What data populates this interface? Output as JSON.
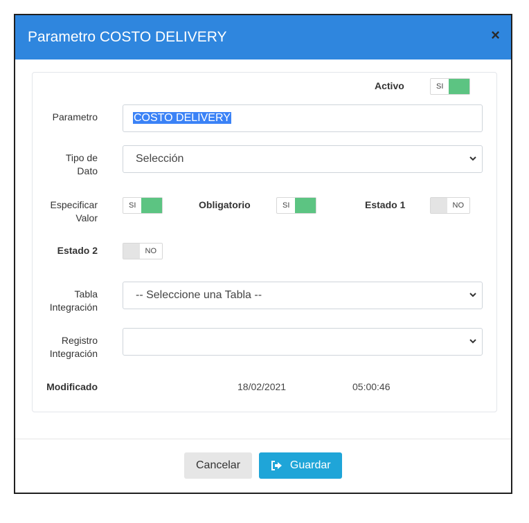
{
  "modal": {
    "title": "Parametro COSTO DELIVERY",
    "close_glyph": "×"
  },
  "form": {
    "activo": {
      "label": "Activo",
      "toggle": "SI",
      "on": true
    },
    "parametro": {
      "label": "Parametro",
      "value": "COSTO DELIVERY"
    },
    "tipo_dato": {
      "label_line1": "Tipo de",
      "label_line2": "Dato",
      "value": "Selección"
    },
    "especificar_valor": {
      "label_line1": "Especificar",
      "label_line2": "Valor",
      "toggle": "SI",
      "on": true
    },
    "obligatorio": {
      "label": "Obligatorio",
      "toggle": "SI",
      "on": true
    },
    "estado1": {
      "label": "Estado 1",
      "toggle": "NO",
      "on": false
    },
    "estado2": {
      "label": "Estado 2",
      "toggle": "NO",
      "on": false
    },
    "tabla_integracion": {
      "label_line1": "Tabla",
      "label_line2": "Integración",
      "value": "-- Seleccione una Tabla --"
    },
    "registro_integracion": {
      "label_line1": "Registro",
      "label_line2": "Integración",
      "value": ""
    },
    "modificado": {
      "label": "Modificado",
      "date": "18/02/2021",
      "time": "05:00:46"
    }
  },
  "footer": {
    "cancel_label": "Cancelar",
    "save_label": "Guardar",
    "save_icon": "save-icon"
  },
  "colors": {
    "header": "#2f86de",
    "toggle_on": "#5cc482",
    "toggle_off": "#e4e4e4",
    "save_button": "#1fa5d8",
    "cancel_button": "#e6e6e6"
  }
}
